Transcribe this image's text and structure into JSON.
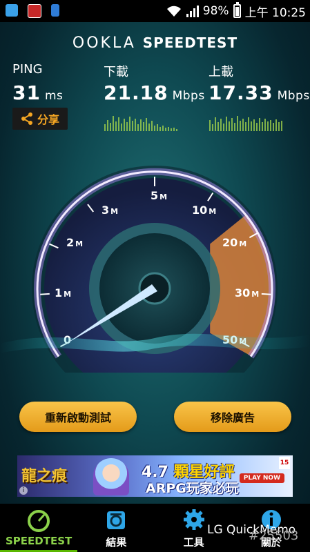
{
  "status_bar": {
    "left_icons": [
      "wifi-notification-icon",
      "antivirus-icon",
      "file-icon"
    ],
    "battery": "98%",
    "time": "上午 10:25"
  },
  "header": {
    "brand": "OOKLA",
    "product": "SPEEDTEST"
  },
  "stats": {
    "ping": {
      "label": "PING",
      "value": "31",
      "unit": "ms"
    },
    "download": {
      "label": "下載",
      "value": "21.18",
      "unit": "Mbps"
    },
    "upload": {
      "label": "上載",
      "value": "17.33",
      "unit": "Mbps"
    }
  },
  "share_label": "分享",
  "gauge": {
    "scale": [
      {
        "num": "0",
        "suffix": ""
      },
      {
        "num": "1",
        "suffix": "M"
      },
      {
        "num": "2",
        "suffix": "M"
      },
      {
        "num": "3",
        "suffix": "M"
      },
      {
        "num": "5",
        "suffix": "M"
      },
      {
        "num": "10",
        "suffix": "M"
      },
      {
        "num": "20",
        "suffix": "M"
      },
      {
        "num": "30",
        "suffix": "M"
      },
      {
        "num": "50",
        "suffix": "M"
      }
    ],
    "needle_value": 0,
    "colors": {
      "accent": "#d8833a",
      "glow": "#b58cff",
      "needle": "#cfe9ff"
    }
  },
  "buttons": {
    "restart": "重新啟動測試",
    "remove_ads": "移除廣告"
  },
  "ad": {
    "game_title": "龍之痕",
    "rating_prefix": "4.7",
    "rating_text": "顆星好評",
    "tagline": "ARPG玩家必玩",
    "play": "PLAY NOW",
    "age": "15"
  },
  "nav": [
    {
      "label": "SPEEDTEST",
      "icon": "speedometer-icon"
    },
    {
      "label": "結果",
      "icon": "results-icon"
    },
    {
      "label": "工具",
      "icon": "gear-icon"
    },
    {
      "label": "關於",
      "icon": "info-icon"
    }
  ],
  "watermark": {
    "text": "LG QuickMemo",
    "id": "#25503"
  }
}
